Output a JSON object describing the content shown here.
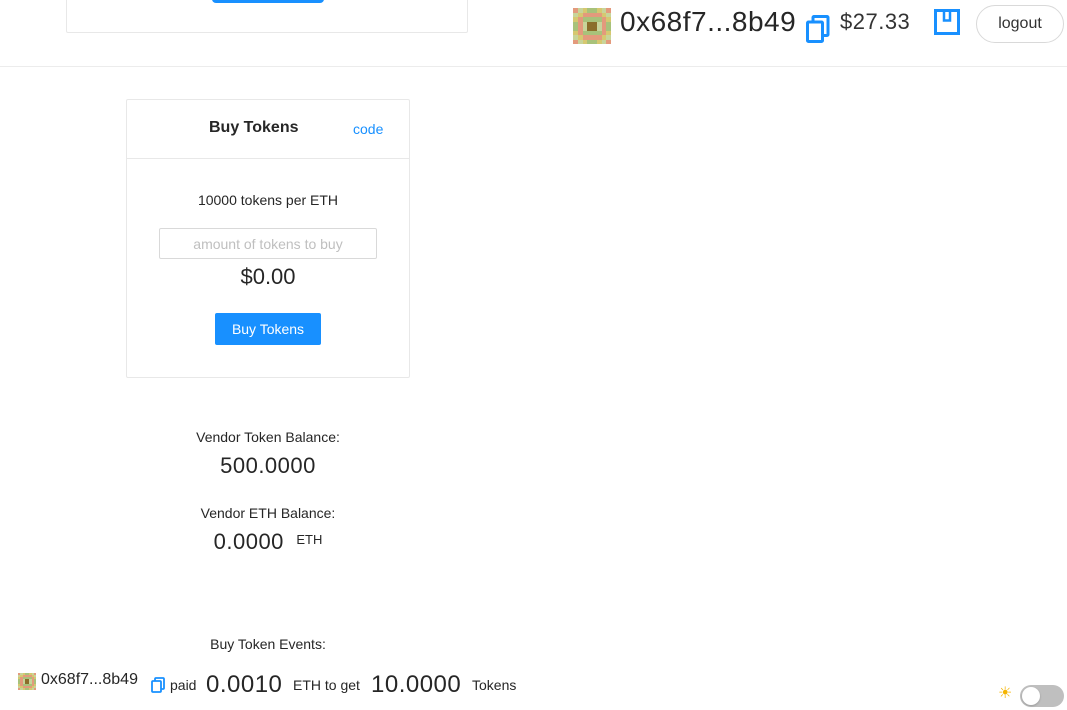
{
  "header": {
    "address": "0x68f7...8b49",
    "balance": "$27.33",
    "logout_label": "logout"
  },
  "buy_card": {
    "title": "Buy Tokens",
    "code_link": "code",
    "rate": "10000 tokens per ETH",
    "amount_placeholder": "amount of tokens to buy",
    "usd_value": "$0.00",
    "buy_button_label": "Buy Tokens"
  },
  "vendor": {
    "token_balance_label": "Vendor Token Balance:",
    "token_balance": "500.0000",
    "eth_balance_label": "Vendor ETH Balance:",
    "eth_balance": "0.0000",
    "eth_unit": "ETH"
  },
  "events": {
    "title": "Buy Token Events:",
    "items": [
      {
        "address": "0x68f7...8b49",
        "paid_label": "paid",
        "eth_amount": "0.0010",
        "eth_label": "ETH to get",
        "token_amount": "10.0000",
        "token_label": "Tokens"
      }
    ]
  },
  "theme": {
    "icon": "sun-icon",
    "glyph": "☀",
    "mode": "light"
  },
  "colors": {
    "primary": "#1890ff",
    "border": "#e8e8e8",
    "text": "#262626",
    "blockie": [
      "#d6c870",
      "#e39a7c",
      "#a8c27a",
      "#c8d49a",
      "#8b6e2a"
    ]
  }
}
